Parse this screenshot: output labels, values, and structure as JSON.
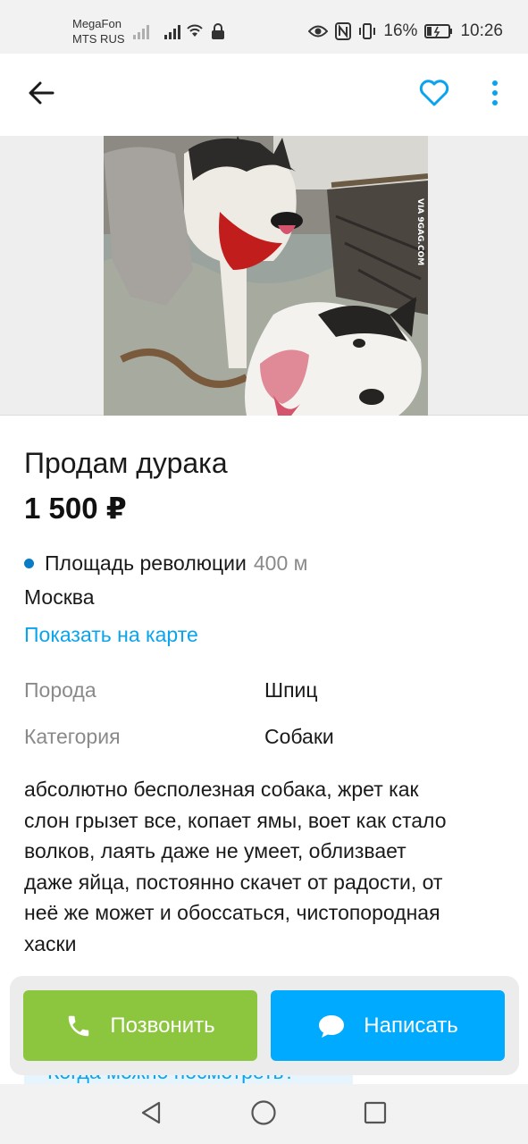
{
  "status_bar": {
    "carrier_1": "MegaFon",
    "carrier_2": "MTS RUS",
    "battery": "16%",
    "time": "10:26"
  },
  "app_bar": {
    "back_icon": "arrow-left",
    "favorite_icon": "heart-outline",
    "more_icon": "more-vertical",
    "accent_color": "#0aa4ee"
  },
  "photo": {
    "watermark": "VIA 9GAG.COM"
  },
  "listing": {
    "title": "Продам дурака",
    "price": "1 500 ₽",
    "metro": "Площадь революции",
    "metro_distance": "400 м",
    "city": "Москва",
    "map_link": "Показать на карте",
    "params": [
      {
        "label": "Порода",
        "value": "Шпиц"
      },
      {
        "label": "Категория",
        "value": "Собаки"
      }
    ],
    "description": "абсолютно бесполезная собака, жрет как\nслон грызет все, копает ямы, воет как стало\nволков, лаять даже не умеет, облизвает\nдаже яйца, постоянно скачет от  радости, от\nнеё же может и обоссаться, чистопородная\nхаски",
    "hidden_link": "Когда можно посмотреть?"
  },
  "actions": {
    "call_label": "Позвонить",
    "message_label": "Написать",
    "call_color": "#8cc63f",
    "message_color": "#00aaff"
  },
  "nav_bar": {
    "back_icon": "triangle-back",
    "home_icon": "circle-home",
    "recents_icon": "square-recents"
  }
}
